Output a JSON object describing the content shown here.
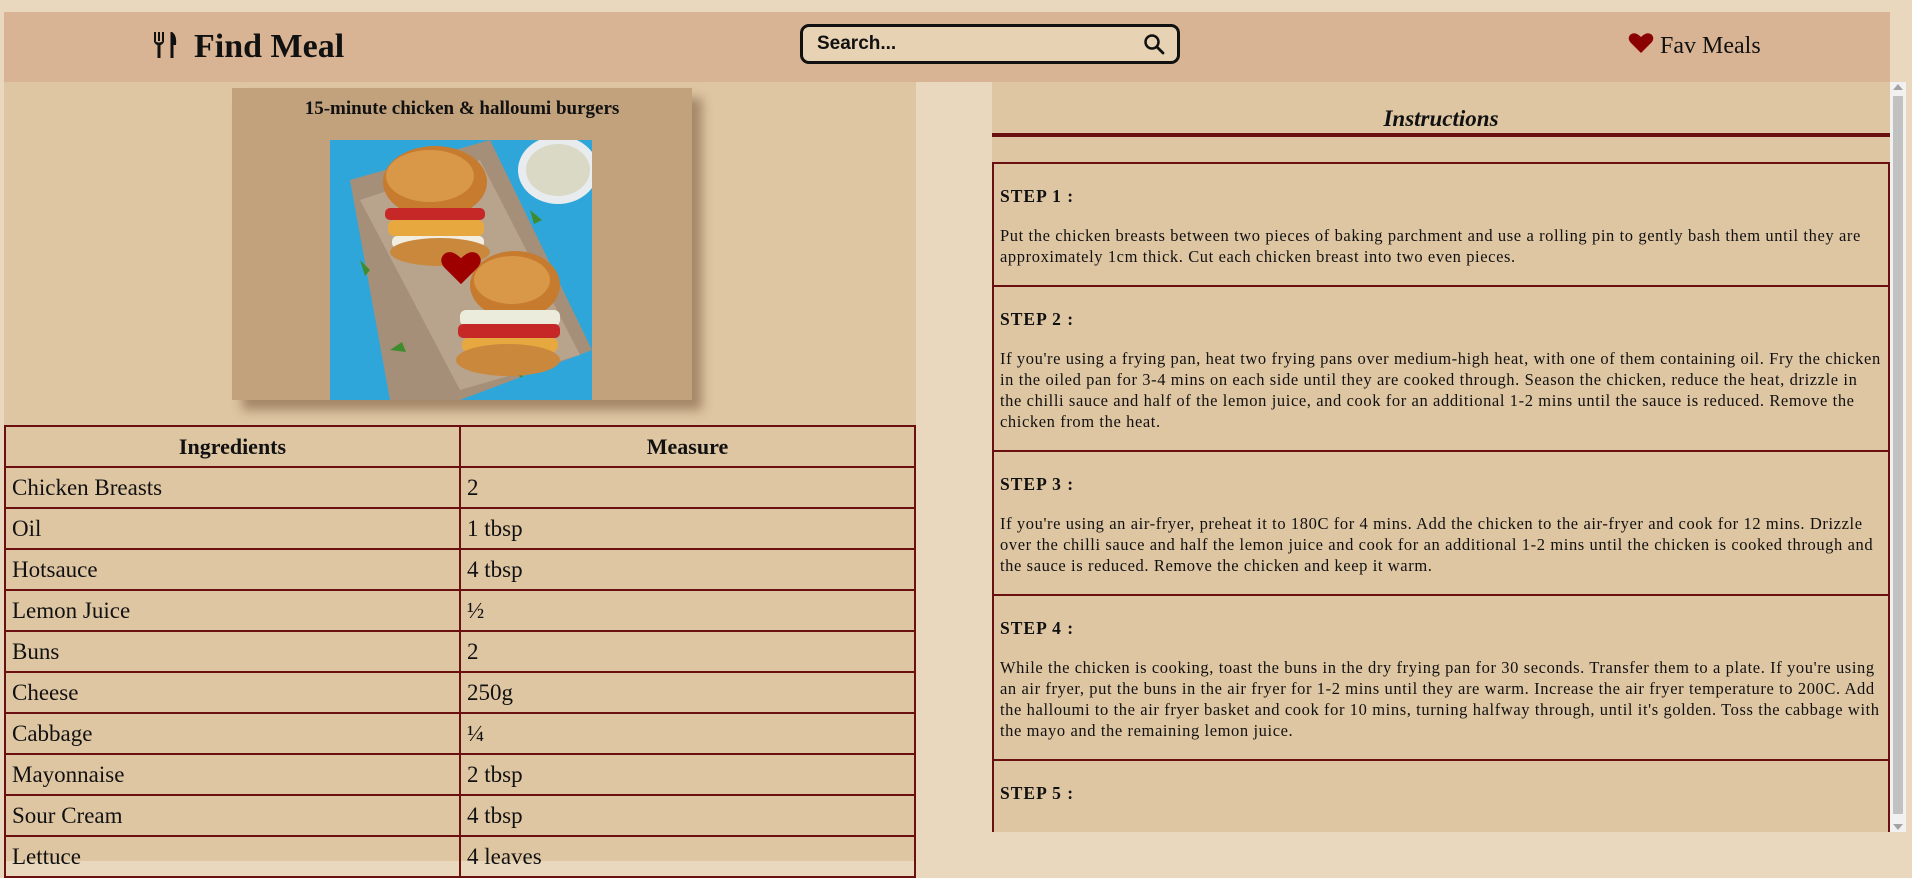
{
  "header": {
    "title": "Find Meal",
    "search_placeholder": "Search...",
    "fav_label": "Fav Meals",
    "brand_icon": "fork-knife-icon",
    "fav_icon": "heart-icon",
    "search_icon": "magnifier-icon",
    "accent_color": "#8b0000"
  },
  "meal": {
    "title": "15-minute chicken & halloumi burgers"
  },
  "ingredients": {
    "col_ingredient": "Ingredients",
    "col_measure": "Measure",
    "rows": [
      {
        "name": "Chicken Breasts",
        "measure": "2"
      },
      {
        "name": "Oil",
        "measure": "1 tbsp"
      },
      {
        "name": "Hotsauce",
        "measure": "4 tbsp"
      },
      {
        "name": "Lemon Juice",
        "measure": "½"
      },
      {
        "name": "Buns",
        "measure": "2"
      },
      {
        "name": "Cheese",
        "measure": "250g"
      },
      {
        "name": "Cabbage",
        "measure": "¼"
      },
      {
        "name": "Mayonnaise",
        "measure": "2 tbsp"
      },
      {
        "name": "Sour Cream",
        "measure": "4 tbsp"
      },
      {
        "name": "Lettuce",
        "measure": "4 leaves"
      }
    ]
  },
  "instructions": {
    "title": "Instructions",
    "steps": [
      {
        "label": "STEP 1 :",
        "text": "Put the chicken breasts between two pieces of baking parchment and use a rolling pin to gently bash them until they are approximately 1cm thick. Cut each chicken breast into two even pieces."
      },
      {
        "label": "STEP 2 :",
        "text": "If you're using a frying pan, heat two frying pans over medium-high heat, with one of them containing oil. Fry the chicken in the oiled pan for 3-4 mins on each side until they are cooked through. Season the chicken, reduce the heat, drizzle in the chilli sauce and half of the lemon juice, and cook for an additional 1-2 mins until the sauce is reduced. Remove the chicken from the heat."
      },
      {
        "label": "STEP 3 :",
        "text": "If you're using an air-fryer, preheat it to 180C for 4 mins. Add the chicken to the air-fryer and cook for 12 mins. Drizzle over the chilli sauce and half the lemon juice and cook for an additional 1-2 mins until the chicken is cooked through and the sauce is reduced. Remove the chicken and keep it warm."
      },
      {
        "label": "STEP 4 :",
        "text": "While the chicken is cooking, toast the buns in the dry frying pan for 30 seconds. Transfer them to a plate. If you're using an air fryer, put the buns in the air fryer for 1-2 mins until they are warm. Increase the air fryer temperature to 200C. Add the halloumi to the air fryer basket and cook for 10 mins, turning halfway through, until it's golden. Toss the cabbage with the mayo and the remaining lemon juice."
      },
      {
        "label": "STEP 5 :",
        "text": ""
      }
    ]
  }
}
